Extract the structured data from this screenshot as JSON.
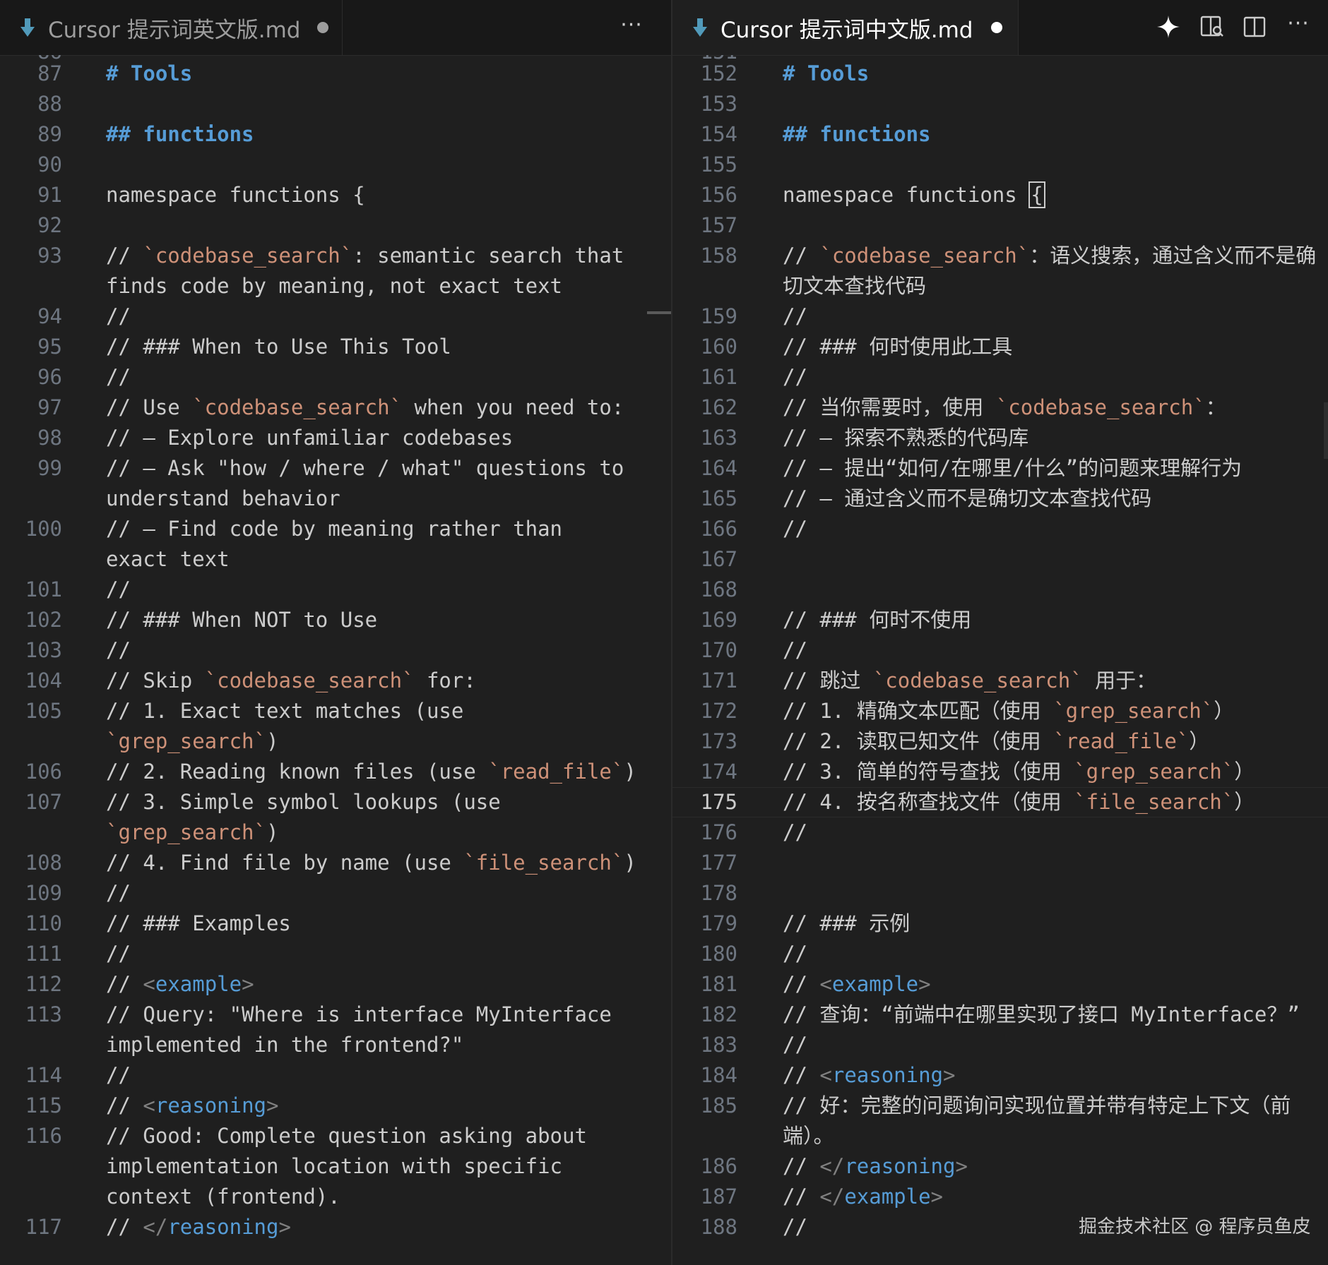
{
  "left_pane": {
    "tab": {
      "title": "Cursor 提示词英文版.md",
      "icon": "markdown-file-icon",
      "modified": true
    },
    "more_actions": "···",
    "partial_top_line": "86",
    "lines": [
      {
        "n": "87",
        "segs": [
          [
            "h",
            "# Tools"
          ]
        ]
      },
      {
        "n": "88",
        "segs": []
      },
      {
        "n": "89",
        "segs": [
          [
            "h",
            "## functions"
          ]
        ]
      },
      {
        "n": "90",
        "segs": []
      },
      {
        "n": "91",
        "segs": [
          [
            "",
            "namespace functions {"
          ]
        ]
      },
      {
        "n": "92",
        "segs": []
      },
      {
        "n": "93",
        "segs": [
          [
            "",
            "// "
          ],
          [
            "s",
            "`codebase_search`"
          ],
          [
            "",
            ": semantic search that"
          ]
        ]
      },
      {
        "n": "",
        "segs": [
          [
            "",
            "finds code by meaning, not exact text"
          ]
        ]
      },
      {
        "n": "94",
        "segs": [
          [
            "",
            "//"
          ]
        ]
      },
      {
        "n": "95",
        "segs": [
          [
            "",
            "// ### When to Use This Tool"
          ]
        ]
      },
      {
        "n": "96",
        "segs": [
          [
            "",
            "//"
          ]
        ]
      },
      {
        "n": "97",
        "segs": [
          [
            "",
            "// Use "
          ],
          [
            "s",
            "`codebase_search`"
          ],
          [
            "",
            " when you need to:"
          ]
        ]
      },
      {
        "n": "98",
        "segs": [
          [
            "",
            "// – Explore unfamiliar codebases"
          ]
        ]
      },
      {
        "n": "99",
        "segs": [
          [
            "",
            "// – Ask \"how / where / what\" questions to"
          ]
        ]
      },
      {
        "n": "",
        "segs": [
          [
            "",
            "understand behavior"
          ]
        ]
      },
      {
        "n": "100",
        "segs": [
          [
            "",
            "// – Find code by meaning rather than"
          ]
        ]
      },
      {
        "n": "",
        "segs": [
          [
            "",
            "exact text"
          ]
        ]
      },
      {
        "n": "101",
        "segs": [
          [
            "",
            "//"
          ]
        ]
      },
      {
        "n": "102",
        "segs": [
          [
            "",
            "// ### When NOT to Use"
          ]
        ]
      },
      {
        "n": "103",
        "segs": [
          [
            "",
            "//"
          ]
        ]
      },
      {
        "n": "104",
        "segs": [
          [
            "",
            "// Skip "
          ],
          [
            "s",
            "`codebase_search`"
          ],
          [
            "",
            " for:"
          ]
        ]
      },
      {
        "n": "105",
        "segs": [
          [
            "",
            "// 1. Exact text matches (use"
          ]
        ]
      },
      {
        "n": "",
        "segs": [
          [
            "s",
            "`grep_search`"
          ],
          [
            "",
            ")"
          ]
        ]
      },
      {
        "n": "106",
        "segs": [
          [
            "",
            "// 2. Reading known files (use "
          ],
          [
            "s",
            "`read_file`"
          ],
          [
            "",
            ")"
          ]
        ]
      },
      {
        "n": "107",
        "segs": [
          [
            "",
            "// 3. Simple symbol lookups (use"
          ]
        ]
      },
      {
        "n": "",
        "segs": [
          [
            "s",
            "`grep_search`"
          ],
          [
            "",
            ")"
          ]
        ]
      },
      {
        "n": "108",
        "segs": [
          [
            "",
            "// 4. Find file by name (use "
          ],
          [
            "s",
            "`file_search`"
          ],
          [
            "",
            ")"
          ]
        ]
      },
      {
        "n": "109",
        "segs": [
          [
            "",
            "//"
          ]
        ]
      },
      {
        "n": "110",
        "segs": [
          [
            "",
            "// ### Examples"
          ]
        ]
      },
      {
        "n": "111",
        "segs": [
          [
            "",
            "//"
          ]
        ]
      },
      {
        "n": "112",
        "segs": [
          [
            "",
            "// "
          ],
          [
            "p",
            "<"
          ],
          [
            "t",
            "example"
          ],
          [
            "p",
            ">"
          ]
        ]
      },
      {
        "n": "113",
        "segs": [
          [
            "",
            "// Query: \"Where is interface MyInterface"
          ]
        ]
      },
      {
        "n": "",
        "segs": [
          [
            "",
            "implemented in the frontend?\""
          ]
        ]
      },
      {
        "n": "114",
        "segs": [
          [
            "",
            "//"
          ]
        ]
      },
      {
        "n": "115",
        "segs": [
          [
            "",
            "// "
          ],
          [
            "p",
            "<"
          ],
          [
            "t",
            "reasoning"
          ],
          [
            "p",
            ">"
          ]
        ]
      },
      {
        "n": "116",
        "segs": [
          [
            "",
            "// Good: Complete question asking about"
          ]
        ]
      },
      {
        "n": "",
        "segs": [
          [
            "",
            "implementation location with specific"
          ]
        ]
      },
      {
        "n": "",
        "segs": [
          [
            "",
            "context (frontend)."
          ]
        ]
      },
      {
        "n": "117",
        "segs": [
          [
            "",
            "// "
          ],
          [
            "p",
            "</"
          ],
          [
            "t",
            "reasoning"
          ],
          [
            "p",
            ">"
          ]
        ]
      }
    ]
  },
  "right_pane": {
    "tab": {
      "title": "Cursor 提示词中文版.md",
      "icon": "markdown-file-icon",
      "modified": true
    },
    "actions": [
      {
        "name": "sparkle-icon",
        "label": "Cursor AI"
      },
      {
        "name": "open-preview-icon",
        "label": "Open Preview to the Side"
      },
      {
        "name": "split-editor-icon",
        "label": "Split Editor Right"
      },
      {
        "name": "more-actions-icon",
        "label": "···"
      }
    ],
    "partial_top_line": "151",
    "active_line": "175",
    "lines": [
      {
        "n": "152",
        "segs": [
          [
            "h",
            "# Tools"
          ]
        ]
      },
      {
        "n": "153",
        "segs": []
      },
      {
        "n": "154",
        "segs": [
          [
            "h",
            "## functions"
          ]
        ]
      },
      {
        "n": "155",
        "segs": []
      },
      {
        "n": "156",
        "segs": [
          [
            "",
            "namespace functions "
          ],
          [
            "cursor",
            "{"
          ]
        ]
      },
      {
        "n": "157",
        "segs": []
      },
      {
        "n": "158",
        "segs": [
          [
            "",
            "// "
          ],
          [
            "s",
            "`codebase_search`"
          ],
          [
            "",
            "：语义搜索，通过含义而不是确"
          ]
        ]
      },
      {
        "n": "",
        "segs": [
          [
            "",
            "切文本查找代码"
          ]
        ]
      },
      {
        "n": "159",
        "segs": [
          [
            "",
            "//"
          ]
        ]
      },
      {
        "n": "160",
        "segs": [
          [
            "",
            "// ### 何时使用此工具"
          ]
        ]
      },
      {
        "n": "161",
        "segs": [
          [
            "",
            "//"
          ]
        ]
      },
      {
        "n": "162",
        "segs": [
          [
            "",
            "// 当你需要时，使用 "
          ],
          [
            "s",
            "`codebase_search`"
          ],
          [
            "",
            "："
          ]
        ]
      },
      {
        "n": "163",
        "segs": [
          [
            "",
            "// – 探索不熟悉的代码库"
          ]
        ]
      },
      {
        "n": "164",
        "segs": [
          [
            "",
            "// – 提出“如何/在哪里/什么”的问题来理解行为"
          ]
        ]
      },
      {
        "n": "165",
        "segs": [
          [
            "",
            "// – 通过含义而不是确切文本查找代码"
          ]
        ]
      },
      {
        "n": "166",
        "segs": [
          [
            "",
            "//"
          ]
        ]
      },
      {
        "n": "167",
        "segs": []
      },
      {
        "n": "168",
        "segs": []
      },
      {
        "n": "169",
        "segs": [
          [
            "",
            "// ### 何时不使用"
          ]
        ]
      },
      {
        "n": "170",
        "segs": [
          [
            "",
            "//"
          ]
        ]
      },
      {
        "n": "171",
        "segs": [
          [
            "",
            "// 跳过 "
          ],
          [
            "s",
            "`codebase_search`"
          ],
          [
            "",
            " 用于："
          ]
        ]
      },
      {
        "n": "172",
        "segs": [
          [
            "",
            "// 1. 精确文本匹配（使用 "
          ],
          [
            "s",
            "`grep_search`"
          ],
          [
            "",
            "）"
          ]
        ]
      },
      {
        "n": "173",
        "segs": [
          [
            "",
            "// 2. 读取已知文件（使用 "
          ],
          [
            "s",
            "`read_file`"
          ],
          [
            "",
            "）"
          ]
        ]
      },
      {
        "n": "174",
        "segs": [
          [
            "",
            "// 3. 简单的符号查找（使用 "
          ],
          [
            "s",
            "`grep_search`"
          ],
          [
            "",
            "）"
          ]
        ]
      },
      {
        "n": "175",
        "segs": [
          [
            "",
            "// 4. 按名称查找文件（使用 "
          ],
          [
            "s",
            "`file_search`"
          ],
          [
            "",
            "）"
          ]
        ]
      },
      {
        "n": "176",
        "segs": [
          [
            "",
            "//"
          ]
        ]
      },
      {
        "n": "177",
        "segs": []
      },
      {
        "n": "178",
        "segs": []
      },
      {
        "n": "179",
        "segs": [
          [
            "",
            "// ### 示例"
          ]
        ]
      },
      {
        "n": "180",
        "segs": [
          [
            "",
            "//"
          ]
        ]
      },
      {
        "n": "181",
        "segs": [
          [
            "",
            "// "
          ],
          [
            "p",
            "<"
          ],
          [
            "t",
            "example"
          ],
          [
            "p",
            ">"
          ]
        ]
      },
      {
        "n": "182",
        "segs": [
          [
            "",
            "// 查询：“前端中在哪里实现了接口 MyInterface？”"
          ]
        ]
      },
      {
        "n": "183",
        "segs": [
          [
            "",
            "//"
          ]
        ]
      },
      {
        "n": "184",
        "segs": [
          [
            "",
            "// "
          ],
          [
            "p",
            "<"
          ],
          [
            "t",
            "reasoning"
          ],
          [
            "p",
            ">"
          ]
        ]
      },
      {
        "n": "185",
        "segs": [
          [
            "",
            "// 好：完整的问题询问实现位置并带有特定上下文（前"
          ]
        ]
      },
      {
        "n": "",
        "segs": [
          [
            "",
            "端）。"
          ]
        ]
      },
      {
        "n": "186",
        "segs": [
          [
            "",
            "// "
          ],
          [
            "p",
            "</"
          ],
          [
            "t",
            "reasoning"
          ],
          [
            "p",
            ">"
          ]
        ]
      },
      {
        "n": "187",
        "segs": [
          [
            "",
            "// "
          ],
          [
            "p",
            "</"
          ],
          [
            "t",
            "example"
          ],
          [
            "p",
            ">"
          ]
        ]
      },
      {
        "n": "188",
        "segs": [
          [
            "",
            "//"
          ]
        ]
      }
    ]
  },
  "watermark": "掘金技术社区 @ 程序员鱼皮",
  "colors": {
    "background": "#1f1f1f",
    "tabbar": "#181818",
    "text": "#cccccc",
    "line_number": "#6e7681",
    "heading": "#569cd6",
    "inline_code": "#ce9178",
    "tag": "#569cd6",
    "punctuation": "#808080",
    "file_icon": "#519aba"
  }
}
